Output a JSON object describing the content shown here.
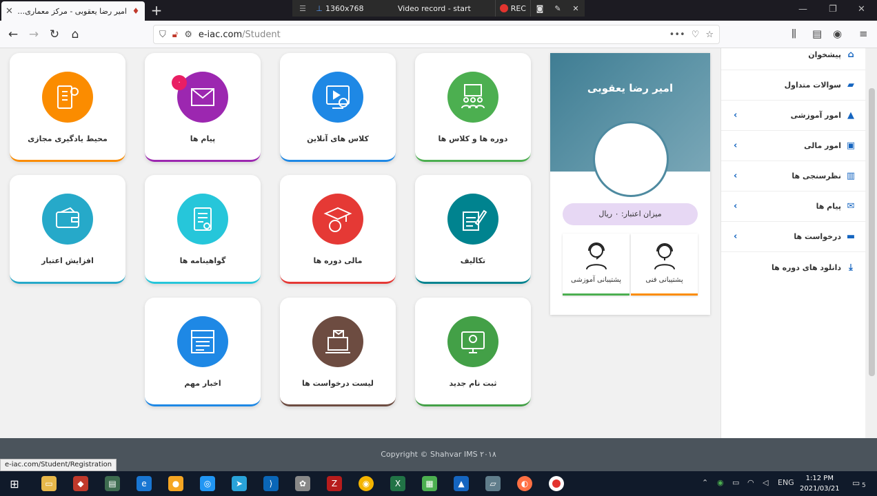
{
  "browser": {
    "tab_title": "امیر رضا یعقوبی - مرکز معماری ایران",
    "new_tab": "+",
    "url_host": "e-iac.com",
    "url_path": "/Student",
    "page_menu": "•••",
    "status_url": "e-iac.com/Student/Registration"
  },
  "recorder": {
    "resolution": "1360x768",
    "title": "Video record - start",
    "rec_label": "REC"
  },
  "cards": [
    {
      "label": "دوره ها و کلاس ها",
      "color": "#4caf50"
    },
    {
      "label": "کلاس های آنلاین",
      "color": "#1e88e5"
    },
    {
      "label": "پیام ها",
      "color": "#9c27b0",
      "badge": "۰"
    },
    {
      "label": "محیط یادگیری مجازی",
      "color": "#fb8c00"
    },
    {
      "label": "تکالیف",
      "color": "#00838f"
    },
    {
      "label": "مالی دوره ها",
      "color": "#e53935"
    },
    {
      "label": "گواهینامه ها",
      "color": "#26c6da"
    },
    {
      "label": "افزایش اعتبار",
      "color": "#26a9c9"
    },
    {
      "label": "ثبت نام جدید",
      "color": "#43a047"
    },
    {
      "label": "لیست درخواست ها",
      "color": "#6d4c41"
    },
    {
      "label": "اخبار مهم",
      "color": "#1e88e5"
    }
  ],
  "profile": {
    "name": "امیر رضا یعقوبی",
    "credit": "میزان اعتبار: ۰ ریال",
    "support_tech": "پشتیبانی فنی",
    "support_edu": "پشتیبانی آموزشی"
  },
  "sidebar": [
    {
      "label": "پیشخوان",
      "icon": "home-icon"
    },
    {
      "label": "سوالات متداول",
      "icon": "faq-icon"
    },
    {
      "label": "امور آموزشی",
      "icon": "education-icon",
      "chevron": true
    },
    {
      "label": "امور مالی",
      "icon": "money-icon",
      "chevron": true
    },
    {
      "label": "نظرسنجی ها",
      "icon": "chart-icon",
      "chevron": true
    },
    {
      "label": "پیام ها",
      "icon": "mail-icon",
      "chevron": true
    },
    {
      "label": "درخواست ها",
      "icon": "request-icon",
      "chevron": true
    },
    {
      "label": "دانلود های دوره ها",
      "icon": "download-icon"
    }
  ],
  "footer": {
    "text": "Copyright © Shahvar IMS ۲۰۱۸"
  },
  "taskbar": {
    "time": "1:12 PM",
    "date": "2021/03/21",
    "lang": "ENG",
    "notif": "5"
  }
}
